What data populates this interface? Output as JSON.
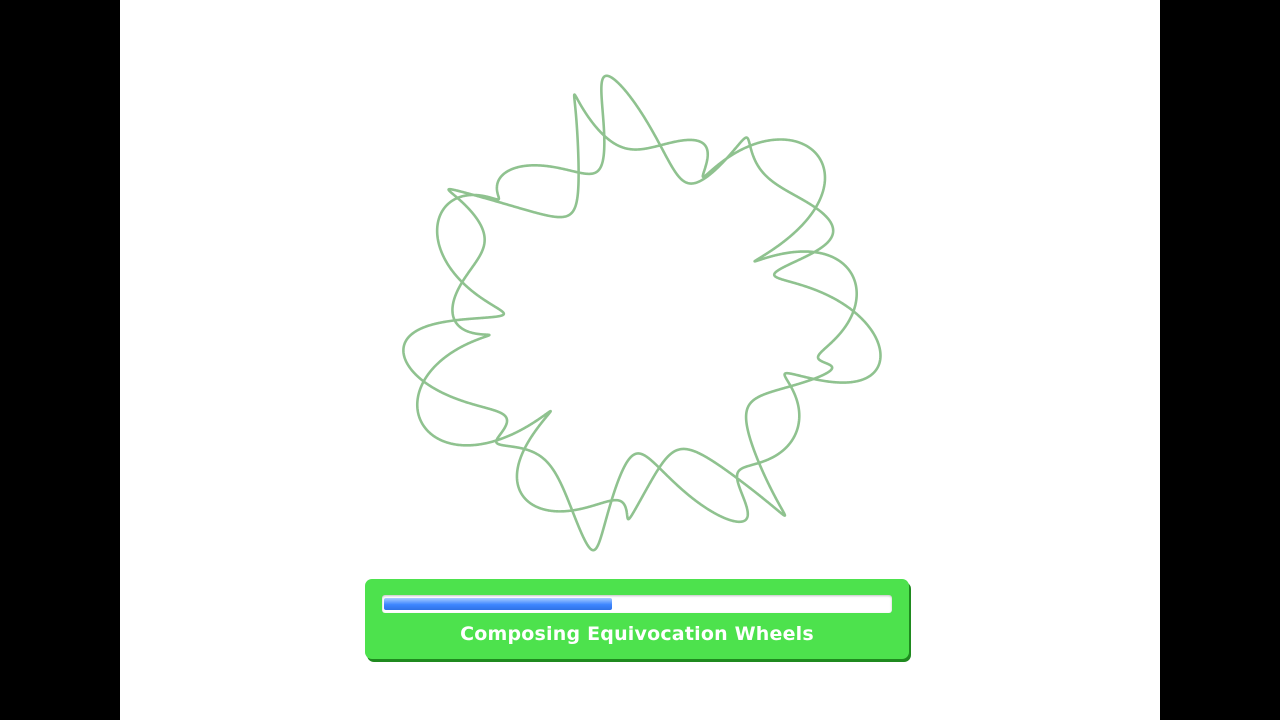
{
  "loading": {
    "label": "Composing Equivocation Wheels",
    "progress": 0.45
  },
  "spirograph": {
    "color": "#8fc28f"
  },
  "colors": {
    "panel": "#4de24d",
    "progress_fill": "#3d86ff",
    "background": "#ffffff",
    "letterbox": "#000000"
  }
}
